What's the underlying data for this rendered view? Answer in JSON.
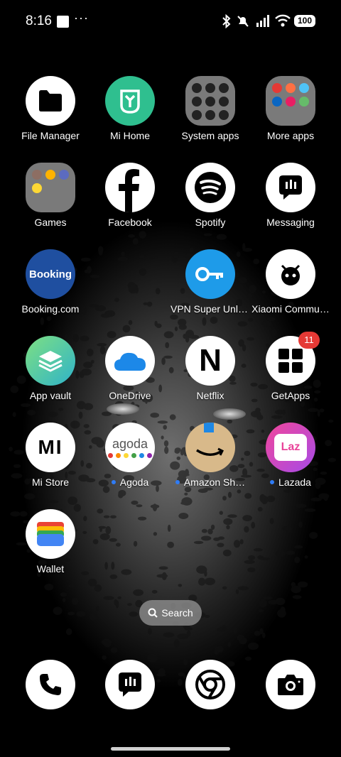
{
  "status_bar": {
    "time": "8:16",
    "more": "···",
    "battery": "100"
  },
  "apps": [
    {
      "label": "File Manager",
      "icon": "folder-icon"
    },
    {
      "label": "Mi Home",
      "icon": "mi-home-icon",
      "color": "#2fbf8f"
    },
    {
      "label": "System apps",
      "icon": "folder-icon"
    },
    {
      "label": "More apps",
      "icon": "folder-icon"
    },
    {
      "label": "Games",
      "icon": "folder-icon"
    },
    {
      "label": "Facebook",
      "icon": "facebook-icon"
    },
    {
      "label": "Spotify",
      "icon": "spotify-icon"
    },
    {
      "label": "Messaging",
      "icon": "messaging-icon"
    },
    {
      "label": "Booking.com",
      "icon": "booking-icon",
      "logo_text": "Booking",
      "color": "#1f4fa0"
    },
    {
      "label": "VPN Super Unli…",
      "icon": "key-icon",
      "color": "#1e9be9"
    },
    {
      "label": "Xiaomi Commu…",
      "icon": "xiaomi-community-icon"
    },
    {
      "label": "App vault",
      "icon": "layers-icon"
    },
    {
      "label": "OneDrive",
      "icon": "cloud-icon"
    },
    {
      "label": "Netflix",
      "icon": "netflix-icon",
      "logo_text": "N"
    },
    {
      "label": "GetApps",
      "icon": "getapps-icon",
      "badge": "11"
    },
    {
      "label": "Mi Store",
      "icon": "mi-store-icon",
      "logo_text": "MI"
    },
    {
      "label": "Agoda",
      "icon": "agoda-icon",
      "logo_text": "agoda"
    },
    {
      "label": "Amazon Sh…",
      "icon": "amazon-icon"
    },
    {
      "label": "Lazada",
      "icon": "lazada-icon",
      "logo_text": "Laz",
      "color": "#e9439a"
    },
    {
      "label": "Wallet",
      "icon": "wallet-icon"
    }
  ],
  "search": {
    "label": "Search"
  },
  "dock": [
    {
      "icon": "phone-icon"
    },
    {
      "icon": "messaging-icon"
    },
    {
      "icon": "chrome-icon"
    },
    {
      "icon": "camera-icon"
    }
  ]
}
